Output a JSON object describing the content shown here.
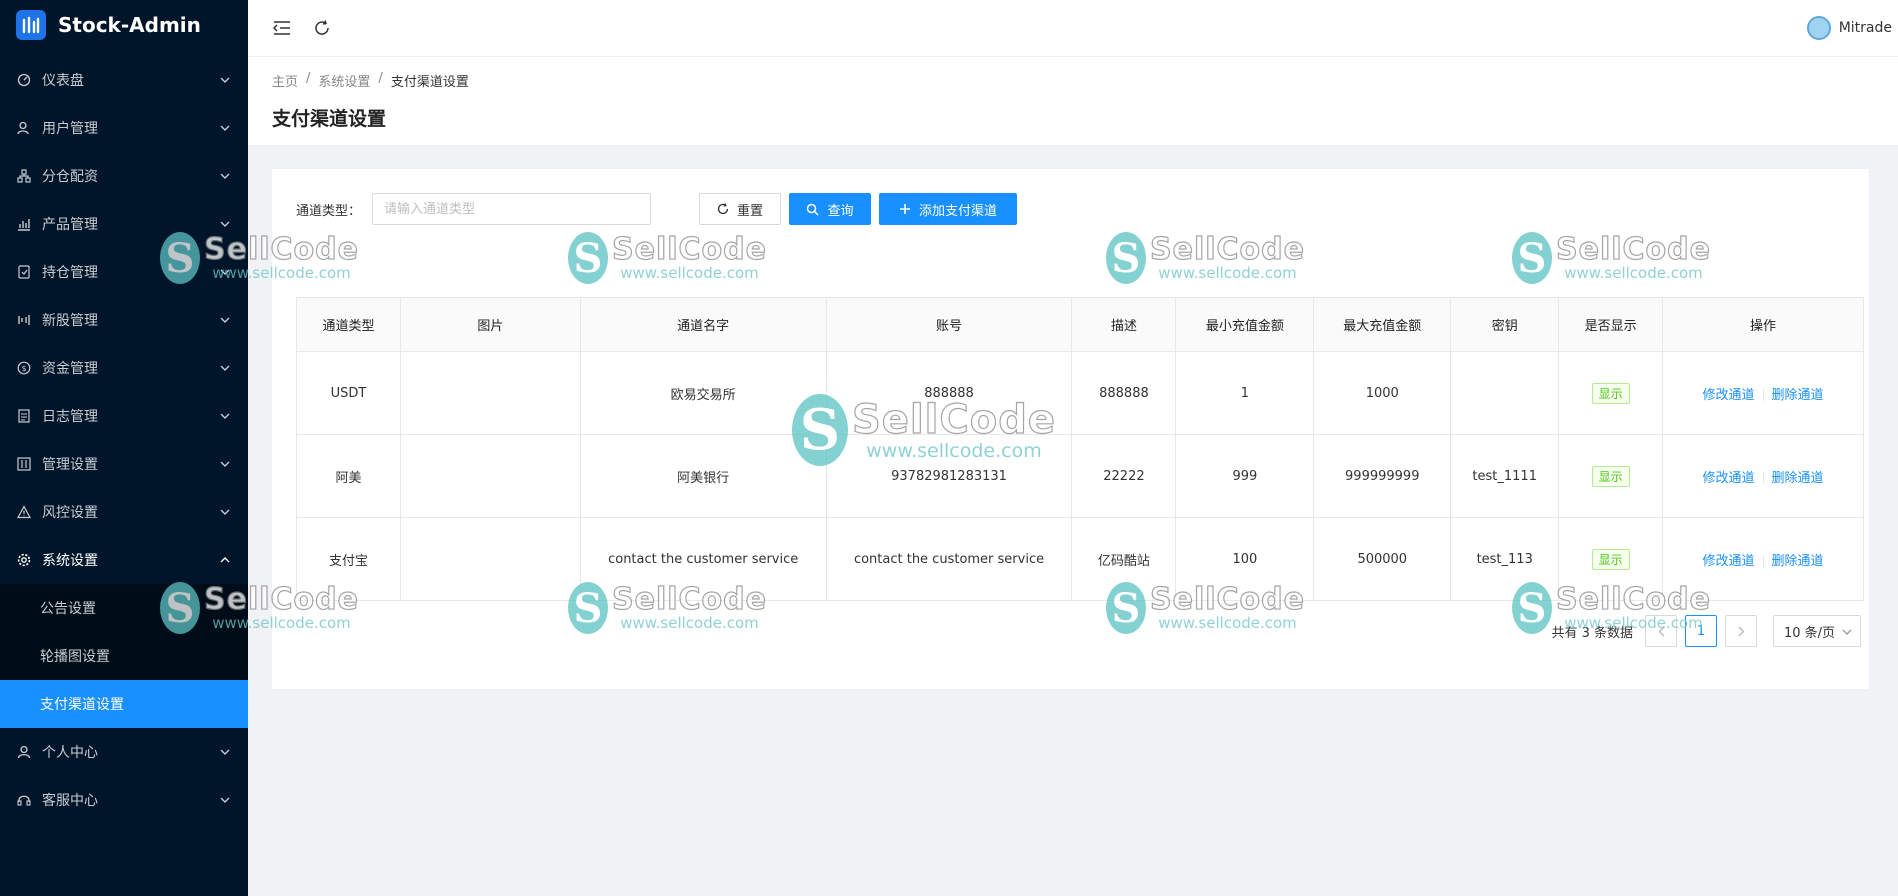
{
  "app": {
    "title": "Stock-Admin"
  },
  "sidebar": {
    "items": [
      {
        "label": "仪表盘",
        "icon": "dashboard-icon"
      },
      {
        "label": "用户管理",
        "icon": "user-group-icon"
      },
      {
        "label": "分仓配资",
        "icon": "cluster-icon"
      },
      {
        "label": "产品管理",
        "icon": "bar-chart-icon"
      },
      {
        "label": "持仓管理",
        "icon": "holding-icon"
      },
      {
        "label": "新股管理",
        "icon": "stock-icon"
      },
      {
        "label": "资金管理",
        "icon": "dollar-icon"
      },
      {
        "label": "日志管理",
        "icon": "log-icon"
      },
      {
        "label": "管理设置",
        "icon": "control-icon"
      },
      {
        "label": "风控设置",
        "icon": "warning-icon"
      },
      {
        "label": "系统设置",
        "icon": "gear-icon"
      }
    ],
    "sub_items": [
      {
        "label": "公告设置"
      },
      {
        "label": "轮播图设置"
      },
      {
        "label": "支付渠道设置"
      }
    ],
    "bottom_items": [
      {
        "label": "个人中心",
        "icon": "user-icon"
      },
      {
        "label": "客服中心",
        "icon": "headset-icon"
      }
    ]
  },
  "header": {
    "user": "Mitrade"
  },
  "breadcrumb": {
    "home": "主页",
    "section": "系统设置",
    "current": "支付渠道设置"
  },
  "page": {
    "title": "支付渠道设置"
  },
  "filter": {
    "label": "通道类型：",
    "placeholder": "请输入通道类型",
    "reset": "重置",
    "query": "查询",
    "add": "添加支付渠道"
  },
  "table": {
    "columns": [
      "通道类型",
      "图片",
      "通道名字",
      "账号",
      "描述",
      "最小充值金额",
      "最大充值金额",
      "密钥",
      "是否显示",
      "操作"
    ],
    "rows": [
      {
        "type": "USDT",
        "image": "",
        "name": "欧易交易所",
        "account": "888888",
        "desc": "888888",
        "min": "1",
        "max": "1000",
        "key": "",
        "show": "显示",
        "edit": "修改通道",
        "delete": "删除通道"
      },
      {
        "type": "阿美",
        "image": "",
        "name": "阿美银行",
        "account": "93782981283131",
        "desc": "22222",
        "min": "999",
        "max": "999999999",
        "key": "test_1111",
        "show": "显示",
        "edit": "修改通道",
        "delete": "删除通道"
      },
      {
        "type": "支付宝",
        "image": "",
        "name": "contact the customer service",
        "account": "contact the customer service",
        "desc": "亿码酷站",
        "min": "100",
        "max": "500000",
        "key": "test_113",
        "show": "显示",
        "edit": "修改通道",
        "delete": "删除通道"
      }
    ]
  },
  "pagination": {
    "total": "共有 3 条数据",
    "current": "1",
    "page_size": "10 条/页"
  },
  "watermark": {
    "brand": "SellCode",
    "url": "www.sellcode.com"
  },
  "colors": {
    "sidebar_bg": "#001529",
    "primary": "#1890ff",
    "tag_green": "#52c41a"
  }
}
